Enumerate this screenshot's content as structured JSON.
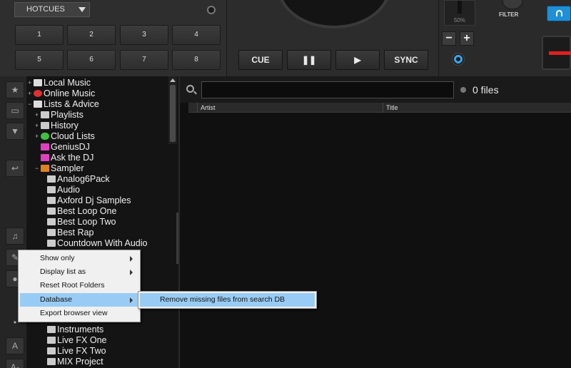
{
  "deck": {
    "hotcues_label": "HOTCUES",
    "pads": [
      "1",
      "2",
      "3",
      "4",
      "5",
      "6",
      "7",
      "8"
    ],
    "cue_label": "CUE",
    "sync_label": "SYNC",
    "pitch_percent": "50%",
    "minus_label": "−",
    "plus_label": "+",
    "filter_label": "FILTER"
  },
  "left_icons": [
    "star-icon",
    "folder-icon",
    "filter-icon",
    "back-icon",
    "music-note-icon",
    "pen-icon",
    "mic-icon",
    "dot-icon",
    "text-a-icon",
    "text-a-small-icon"
  ],
  "left_icon_glyphs": [
    "★",
    "▭",
    "▼",
    "↩",
    "♫",
    "✎",
    "●",
    "•",
    "A",
    "Aₐ"
  ],
  "tree": {
    "nodes": [
      {
        "label": "Local Music",
        "color": "#dddddd"
      },
      {
        "label": "Online Music",
        "color": "#e03030"
      },
      {
        "label": "Lists & Advice",
        "color": "#dddddd"
      },
      {
        "label": "Playlists",
        "color": "#cccccc"
      },
      {
        "label": "History",
        "color": "#cccccc"
      },
      {
        "label": "Cloud Lists",
        "color": "#40c040"
      },
      {
        "label": "GeniusDJ",
        "color": "#e040c0"
      },
      {
        "label": "Ask the DJ",
        "color": "#e040c0"
      },
      {
        "label": "Sampler",
        "color": "#e08020"
      },
      {
        "label": "Analog6Pack",
        "color": "#cccccc"
      },
      {
        "label": "Audio",
        "color": "#cccccc"
      },
      {
        "label": "Axford Dj Samples",
        "color": "#cccccc"
      },
      {
        "label": "Best Loop One",
        "color": "#cccccc"
      },
      {
        "label": "Best Loop Two",
        "color": "#cccccc"
      },
      {
        "label": "Best Rap",
        "color": "#cccccc"
      },
      {
        "label": "Countdown With Audio",
        "color": "#cccccc"
      },
      {
        "label": "Instruments",
        "color": "#cccccc"
      },
      {
        "label": "Live FX One",
        "color": "#cccccc"
      },
      {
        "label": "Live FX Two",
        "color": "#cccccc"
      },
      {
        "label": "MIX Project",
        "color": "#cccccc"
      }
    ],
    "folders_tab": "folders"
  },
  "filelist": {
    "search_value": "",
    "files_count": "0 files",
    "columns": [
      "Artist",
      "Title"
    ]
  },
  "context_menu": {
    "items": [
      {
        "label": "Show only",
        "submenu": true
      },
      {
        "label": "Display list as",
        "submenu": true
      },
      {
        "label": "Reset Root Folders",
        "submenu": false
      },
      {
        "label": "Database",
        "submenu": true
      },
      {
        "label": "Export browser view",
        "submenu": false
      }
    ],
    "submenu_item": "Remove missing files from search DB"
  }
}
